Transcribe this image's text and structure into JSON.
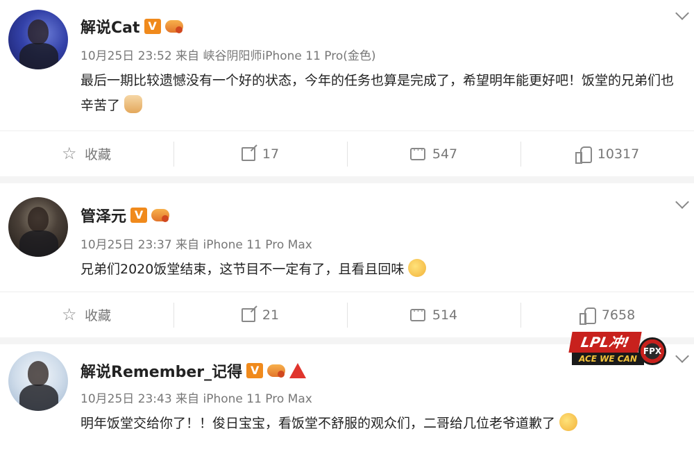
{
  "posts": [
    {
      "author": "解说Cat",
      "meta": "10月25日 23:52 来自 峡谷阴阳师iPhone 11 Pro(金色)",
      "text": "最后一期比较遗憾没有一个好的状态，今年的任务也算是完成了，希望明年能更好吧！饭堂的兄弟们也辛苦了",
      "emoji": "thumbs-up-emoji",
      "actions": {
        "favorite": "收藏",
        "repost": "17",
        "comment": "547",
        "like": "10317"
      }
    },
    {
      "author": "管泽元",
      "meta": "10月25日 23:37 来自 iPhone 11 Pro Max",
      "text": "兄弟们2020饭堂结束，这节目不一定有了，且看且回味",
      "emoji": "doge-emoji",
      "actions": {
        "favorite": "收藏",
        "repost": "21",
        "comment": "514",
        "like": "7658"
      }
    },
    {
      "author": "解说Remember_记得",
      "meta": "10月25日 23:43 来自 iPhone 11 Pro Max",
      "text": "明年饭堂交给你了！！俊日宝宝，看饭堂不舒服的观众们，二哥给几位老爷道歉了",
      "emoji": "shy-face-emoji"
    }
  ],
  "banner": {
    "top": "LPL冲!",
    "bottom": "ACE WE CAN",
    "logo": "FPX"
  },
  "badges": {
    "verified": "V"
  },
  "colors": {
    "accent": "#f08a1c",
    "text": "#222222",
    "muted": "#777777"
  }
}
